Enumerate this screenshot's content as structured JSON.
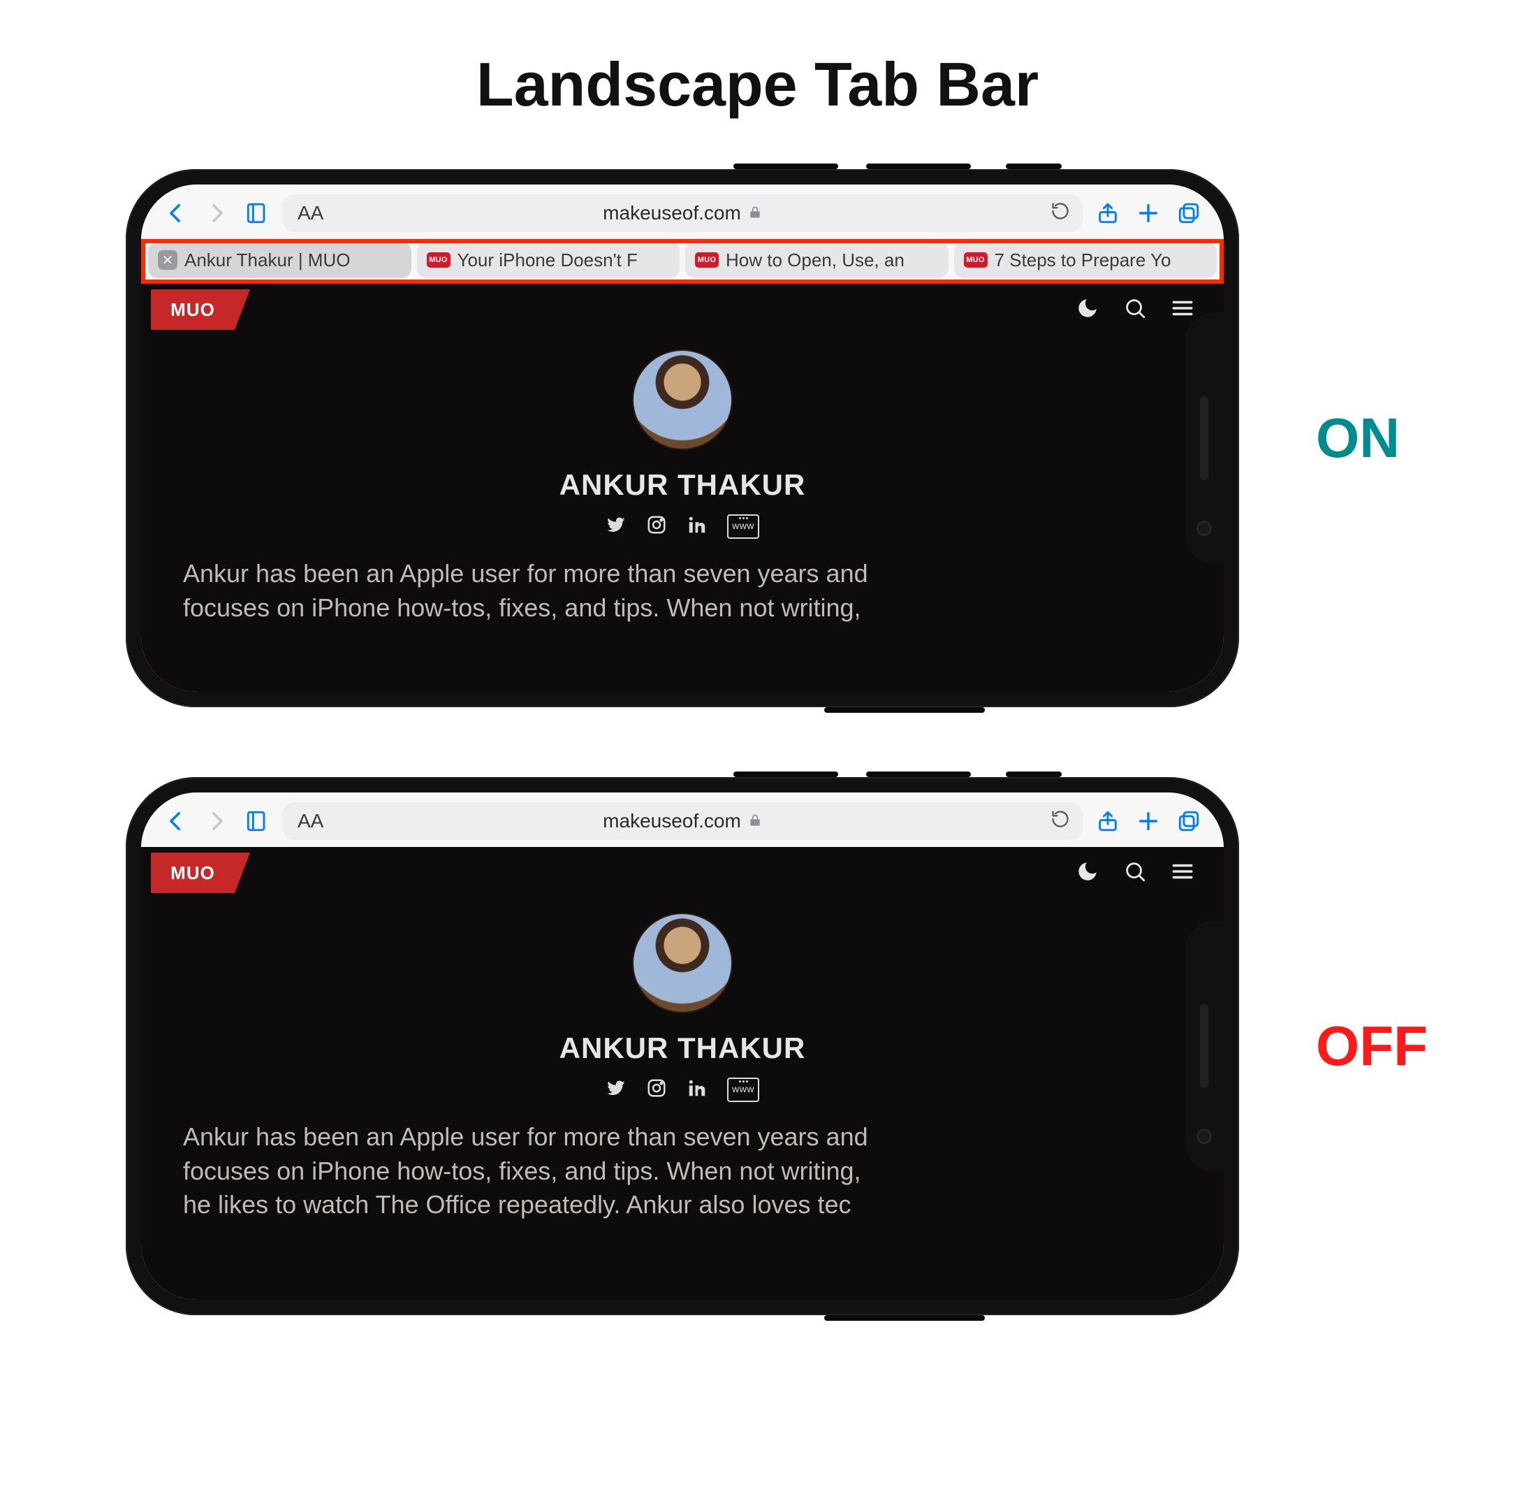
{
  "title": "Landscape Tab Bar",
  "labels": {
    "on": "ON",
    "off": "OFF"
  },
  "safari": {
    "aa": "AA",
    "url": "makeuseof.com",
    "tabs": [
      {
        "label": "Ankur Thakur | MUO",
        "active": true
      },
      {
        "label": "Your iPhone Doesn't F"
      },
      {
        "label": "How to Open, Use, an"
      },
      {
        "label": "7 Steps to Prepare Yo"
      }
    ]
  },
  "page": {
    "logo": "MUO",
    "author": "ANKUR THAKUR",
    "www": "www",
    "bio_on_l1": "Ankur has been an Apple user for more than seven years and",
    "bio_on_l2": "focuses on iPhone how-tos, fixes, and tips. When not writing,",
    "bio_off_l1": "Ankur has been an Apple user for more than seven years and",
    "bio_off_l2": "focuses on iPhone how-tos, fixes, and tips. When not writing,",
    "bio_off_l3": "he likes to watch The Office repeatedly. Ankur also loves tec"
  }
}
